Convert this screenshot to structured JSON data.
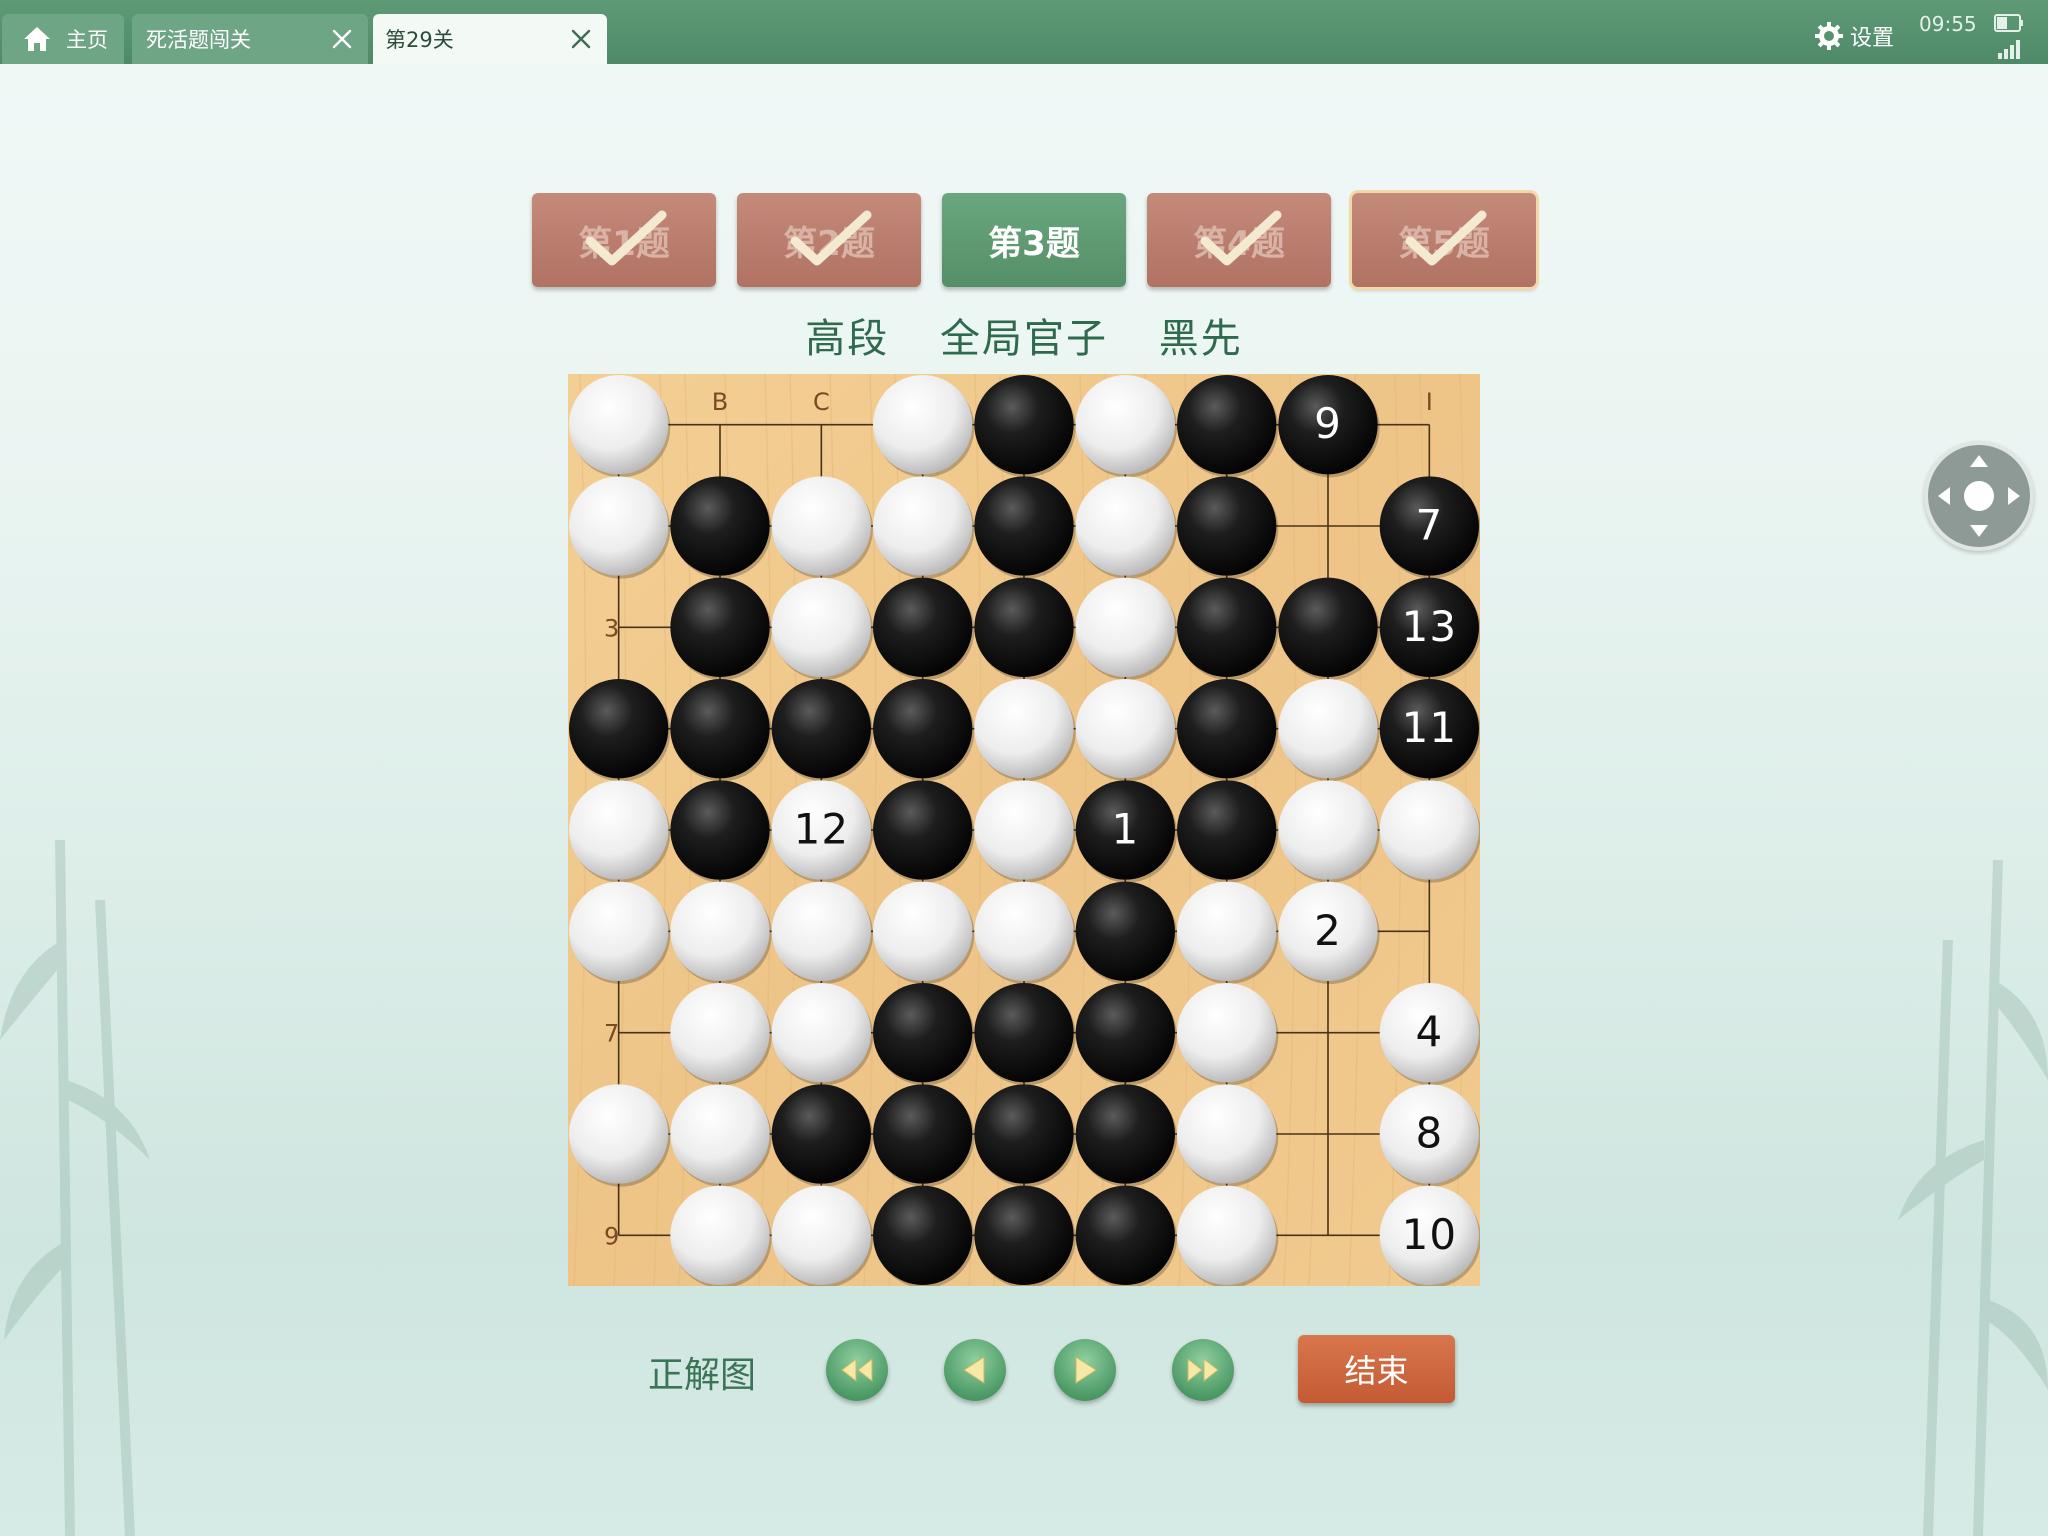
{
  "tabs": [
    {
      "label": "主页",
      "icon": "home-icon"
    },
    {
      "label": "死活题闯关",
      "icon": "close-icon"
    },
    {
      "label": "第29关",
      "icon": "close-icon",
      "active": true
    }
  ],
  "status": {
    "settings_label": "设置",
    "time": "09:55"
  },
  "problems": [
    {
      "label": "第1题",
      "solved": true
    },
    {
      "label": "第2题",
      "solved": true
    },
    {
      "label": "第3题",
      "solved": false,
      "current": true
    },
    {
      "label": "第4题",
      "solved": true
    },
    {
      "label": "第5题",
      "solved": true
    }
  ],
  "problem_info": {
    "level": "高段",
    "type": "全局官子",
    "first_move": "黑先"
  },
  "board": {
    "size": 9,
    "row_labels": {
      "3": "3",
      "7": "7",
      "9": "9"
    },
    "col_labels": {
      "2": "B",
      "3": "C",
      "9": "I"
    },
    "stones": [
      "W..WBWB9.",
      "WBWWBWB.7",
      ".BWBBWBBD",
      "BBBBWWBWE",
      "WBLBWAB WW",
      "WWWWWBW2.",
      ".WWBBBW.4",
      "WWBBBBW.8",
      ".WWBBBW.T"
    ],
    "move_numbers": {
      "0-7": 9,
      "1-8": 7,
      "2-8": 13,
      "3-8": 11,
      "4-2": 12,
      "4-5": 1,
      "5-7": 2,
      "6-8": 4,
      "7-8": 8,
      "8-8": 10
    }
  },
  "controls": {
    "solution_label": "正解图",
    "end_label": "结束"
  },
  "colors": {
    "tab_bar": "#4f8a68",
    "board_wood": "#efc98d",
    "solved_button": "#b77a6a",
    "current_button": "#5e9b72",
    "end_button": "#cf6a3f"
  }
}
